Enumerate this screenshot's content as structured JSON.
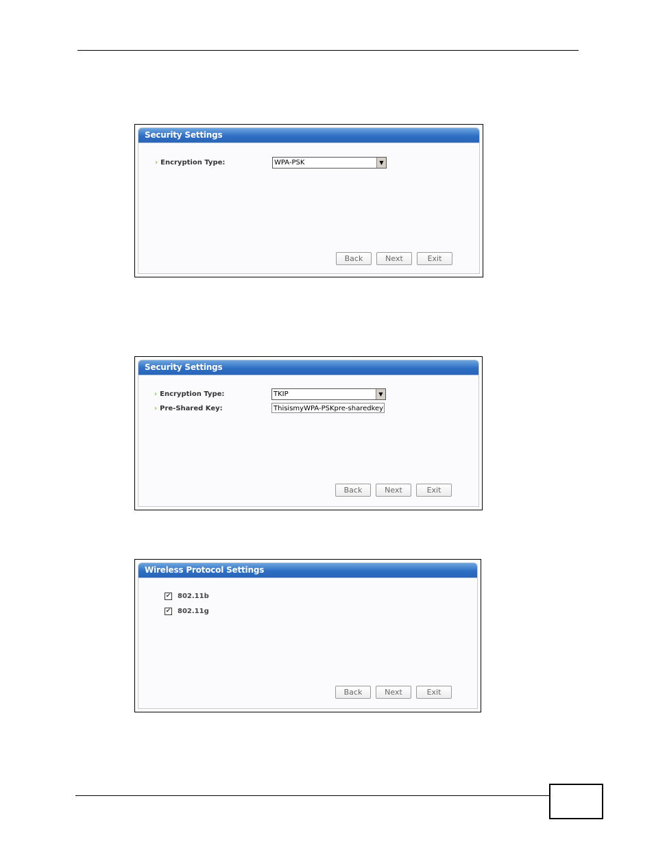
{
  "screens": [
    {
      "title": "Security Settings",
      "fields": [
        {
          "label": "Encryption Type:",
          "type": "select",
          "value": "WPA-PSK"
        }
      ],
      "buttons": [
        "Back",
        "Next",
        "Exit"
      ]
    },
    {
      "title": "Security Settings",
      "fields": [
        {
          "label": "Encryption Type:",
          "type": "select",
          "value": "TKIP"
        },
        {
          "label": "Pre-Shared Key:",
          "type": "text",
          "value": "ThisismyWPA-PSKpre-sharedkey"
        }
      ],
      "buttons": [
        "Back",
        "Next",
        "Exit"
      ]
    },
    {
      "title": "Wireless Protocol Settings",
      "checkboxes": [
        {
          "label": "802.11b",
          "checked": true
        },
        {
          "label": "802.11g",
          "checked": true
        }
      ],
      "buttons": [
        "Back",
        "Next",
        "Exit"
      ]
    }
  ],
  "icons": {
    "bullet": "›",
    "dropdown_arrow": "▼",
    "check": "✔"
  },
  "colors": {
    "titlebar": "#2e6fc4",
    "bullet": "#8cc63f"
  }
}
